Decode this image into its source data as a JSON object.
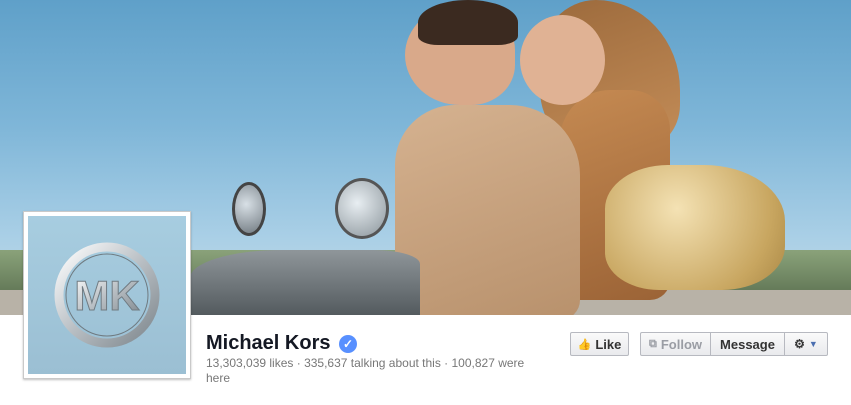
{
  "page": {
    "name": "Michael Kors",
    "stats": "13,303,039 likes · 335,637 talking about this · 100,827 were here",
    "profile_logo_text": "MK"
  },
  "actions": {
    "like_label": "Like",
    "follow_label": "Follow",
    "message_label": "Message"
  },
  "icons": {
    "like": "thumbs-up-icon",
    "follow": "rss-icon",
    "settings": "gear-icon",
    "dropdown": "caret-down-icon",
    "verified": "check-icon"
  },
  "colors": {
    "verified_badge": "#5890ff",
    "name_text": "#141823",
    "stats_text": "#777777"
  }
}
